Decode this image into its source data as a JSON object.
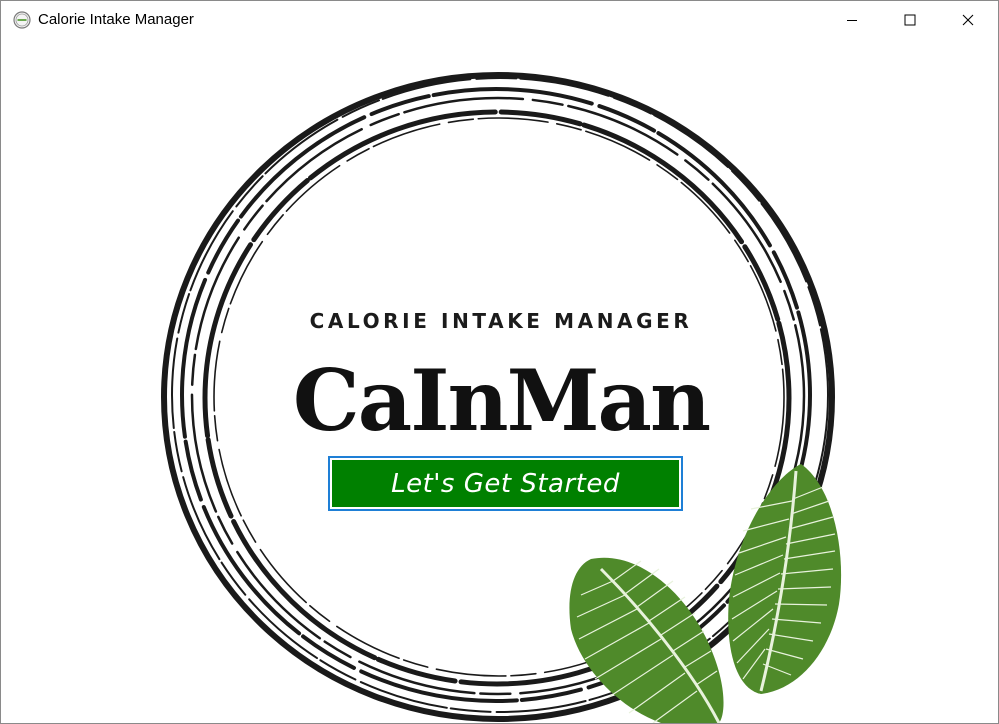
{
  "window": {
    "title": "Calorie Intake Manager",
    "controls": {
      "minimize": "minimize",
      "maximize": "maximize",
      "close": "close"
    }
  },
  "splash": {
    "subtitle": "CALORIE INTAKE MANAGER",
    "brand": "CaInMan",
    "start_button_label": "Let's Get Started"
  },
  "colors": {
    "button_fill": "#008000",
    "button_focus_border": "#1e7fd6",
    "ring": "#1a1a1a",
    "leaf": "#4f8a2a"
  },
  "icons": [
    "app-icon",
    "minimize-icon",
    "maximize-icon",
    "close-icon",
    "leaf-decoration"
  ]
}
